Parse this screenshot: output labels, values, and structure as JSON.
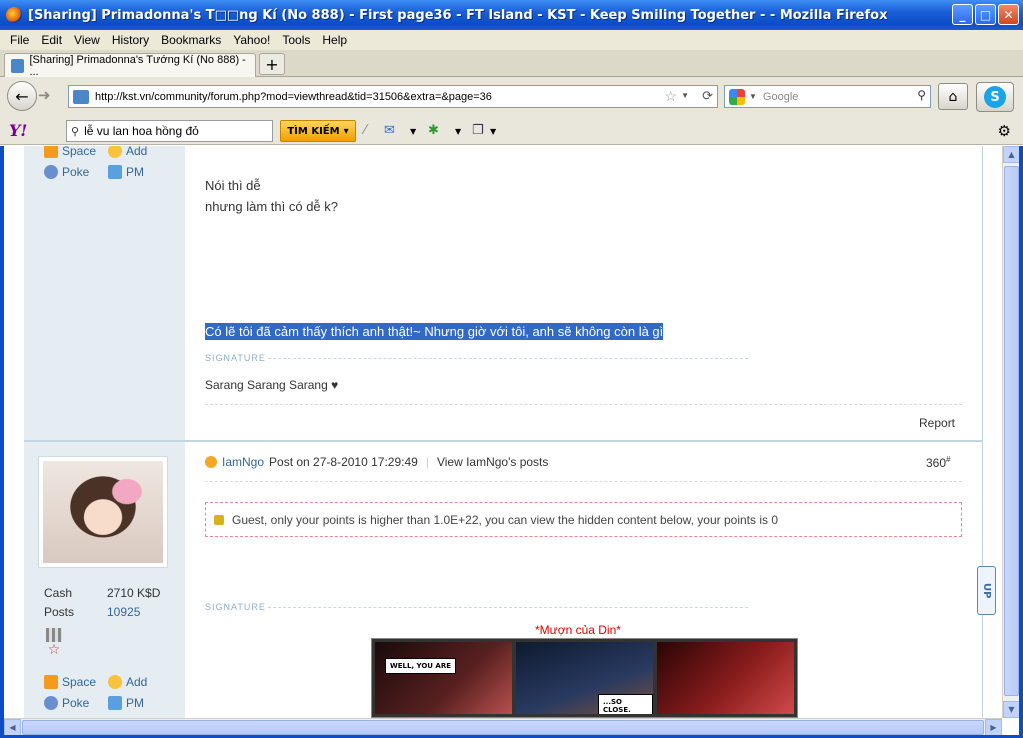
{
  "window": {
    "title": "[Sharing] Primadonna's T□□ng Kí (No 888) - First page36 - FT Island - KST - Keep Smiling Together - - Mozilla Firefox",
    "minimize": "_",
    "maximize": "□",
    "close": "✕"
  },
  "menu": [
    "File",
    "Edit",
    "View",
    "History",
    "Bookmarks",
    "Yahoo!",
    "Tools",
    "Help"
  ],
  "tab": {
    "label": "[Sharing] Primadonna's Tướng Kí (No 888) - ..."
  },
  "nav": {
    "url": "http://kst.vn/community/forum.php?mod=viewthread&tid=31506&extra=&page=36",
    "search_placeholder": "Google"
  },
  "yahoo": {
    "logo": "Y!",
    "search_value": "lễ vu lan hoa hồng đỏ",
    "search_button": "TÌM KIẾM"
  },
  "post1": {
    "links": {
      "space": "Space",
      "add": "Add",
      "poke": "Poke",
      "pm": "PM"
    },
    "line1": "Nói thì dễ",
    "line2": "nhưng làm thì có dễ k?",
    "highlight": "Có lẽ tôi đã cảm thấy thích anh thật!~ Nhưng giờ với tôi, anh sẽ không còn là gì",
    "signature_label": "SIGNATURE",
    "signature": "Sarang Sarang Sarang ♥",
    "report": "Report"
  },
  "post2": {
    "author": "IamNgo",
    "posted": "Post on 27-8-2010 17:29:49",
    "view_posts": "View IamNgo's posts",
    "number": "360",
    "number_sup": "#",
    "cash_label": "Cash",
    "cash_value": "2710 K$D",
    "posts_label": "Posts",
    "posts_value": "10925",
    "locked_notice": "Guest, only your points is higher than 1.0E+22, you can view the hidden content below, your points is 0",
    "signature_label": "SIGNATURE",
    "sig_title": "*Mượn của Din*",
    "bubble1": "WELL, YOU ARE",
    "bubble2": "...SO CLOSE.",
    "links": {
      "space": "Space",
      "add": "Add",
      "poke": "Poke",
      "pm": "PM"
    }
  },
  "scroll_up": "UP"
}
